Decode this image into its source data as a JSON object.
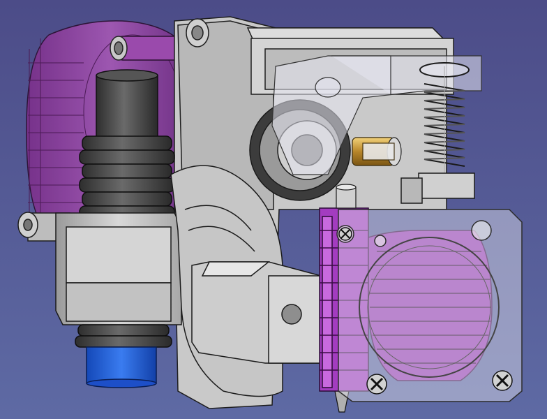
{
  "viewport": {
    "background_top": "#4c4c88",
    "background_bottom": "#5e6aa4"
  },
  "colors": {
    "body_grey": "#cfcfcf",
    "body_shadow": "#9e9e9e",
    "edge": "#222222",
    "fan_purple": "#8a3d96",
    "fan_purple_light": "#b066bf",
    "heatsink_purple": "#a53ec2",
    "dark_tube": "#4a4a4a",
    "bowden_blue": "#1d5fe0",
    "brass": "#d6a53a",
    "transparent_part": "#e8e8f0"
  },
  "icons": {
    "cap_screw": "cap-screw-icon",
    "cross_screw": "cross-screw-icon"
  }
}
